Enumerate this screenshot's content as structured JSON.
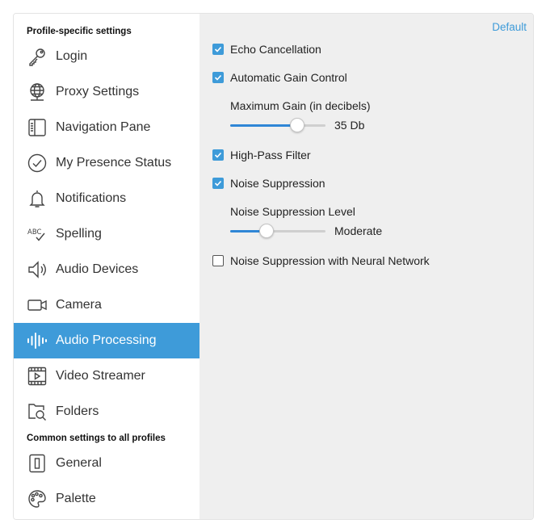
{
  "sidebar": {
    "profile_header": "Profile-specific settings",
    "common_header": "Common settings to all profiles",
    "items": [
      {
        "label": "Login",
        "icon": "key-icon"
      },
      {
        "label": "Proxy Settings",
        "icon": "globe-network-icon"
      },
      {
        "label": "Navigation Pane",
        "icon": "navigation-pane-icon"
      },
      {
        "label": "My Presence Status",
        "icon": "checkmark-circle-icon"
      },
      {
        "label": "Notifications",
        "icon": "bell-icon"
      },
      {
        "label": "Spelling",
        "icon": "spelling-icon",
        "icon_text": "ABC"
      },
      {
        "label": "Audio Devices",
        "icon": "speaker-icon"
      },
      {
        "label": "Camera",
        "icon": "camera-icon"
      },
      {
        "label": "Audio Processing",
        "icon": "audio-waveform-icon",
        "active": true
      },
      {
        "label": "Video Streamer",
        "icon": "video-play-icon"
      },
      {
        "label": "Folders",
        "icon": "folder-search-icon"
      }
    ],
    "common_items": [
      {
        "label": "General",
        "icon": "general-device-icon"
      },
      {
        "label": "Palette",
        "icon": "palette-icon"
      }
    ]
  },
  "content": {
    "default_link": "Default",
    "echo_cancellation": {
      "label": "Echo Cancellation",
      "checked": true
    },
    "agc": {
      "label": "Automatic Gain Control",
      "checked": true
    },
    "max_gain": {
      "label": "Maximum Gain (in decibels)",
      "value": "35 Db",
      "fraction": 0.7
    },
    "high_pass": {
      "label": "High-Pass Filter",
      "checked": true
    },
    "noise_suppression": {
      "label": "Noise Suppression",
      "checked": true
    },
    "ns_level": {
      "label": "Noise Suppression Level",
      "value": "Moderate",
      "fraction": 0.38
    },
    "ns_neural": {
      "label": "Noise Suppression with Neural Network",
      "checked": false
    }
  },
  "colors": {
    "accent": "#3e9bd9",
    "slider_fill": "#2f86d6",
    "content_bg": "#efefef"
  }
}
